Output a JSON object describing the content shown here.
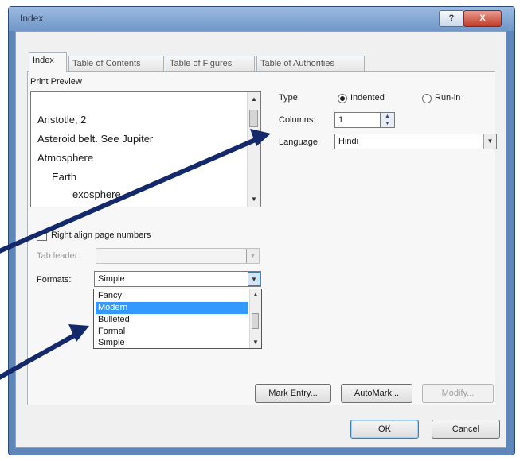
{
  "window": {
    "title": "Index",
    "help_glyph": "?",
    "close_glyph": "X"
  },
  "tabs": [
    {
      "label": "Index",
      "active": true
    },
    {
      "label": "Table of Contents",
      "active": false
    },
    {
      "label": "Table of Figures",
      "active": false
    },
    {
      "label": "Table of Authorities",
      "active": false
    }
  ],
  "print_preview": {
    "label": "Print Preview",
    "lines": [
      "Aristotle, 2",
      "Asteroid belt. See Jupiter",
      "Atmosphere",
      "Earth",
      "exosphere"
    ]
  },
  "type": {
    "label": "Type:",
    "options": [
      {
        "label": "Indented",
        "selected": true
      },
      {
        "label": "Run-in",
        "selected": false
      }
    ]
  },
  "columns": {
    "label": "Columns:",
    "value": "1"
  },
  "language": {
    "label": "Language:",
    "value": "Hindi"
  },
  "right_align": {
    "label": "Right align page numbers",
    "checked": false
  },
  "tab_leader": {
    "label": "Tab leader:",
    "value": ""
  },
  "formats": {
    "label": "Formats:",
    "value": "Simple",
    "options": [
      "Fancy",
      "Modern",
      "Bulleted",
      "Formal",
      "Simple"
    ],
    "highlighted": "Modern"
  },
  "buttons": {
    "mark_entry": "Mark Entry...",
    "automark": "AutoMark...",
    "modify": "Modify...",
    "ok": "OK",
    "cancel": "Cancel"
  },
  "colors": {
    "frame": "#5f86b9",
    "annotation_arrow": "#13296b",
    "selection": "#3399ff"
  }
}
